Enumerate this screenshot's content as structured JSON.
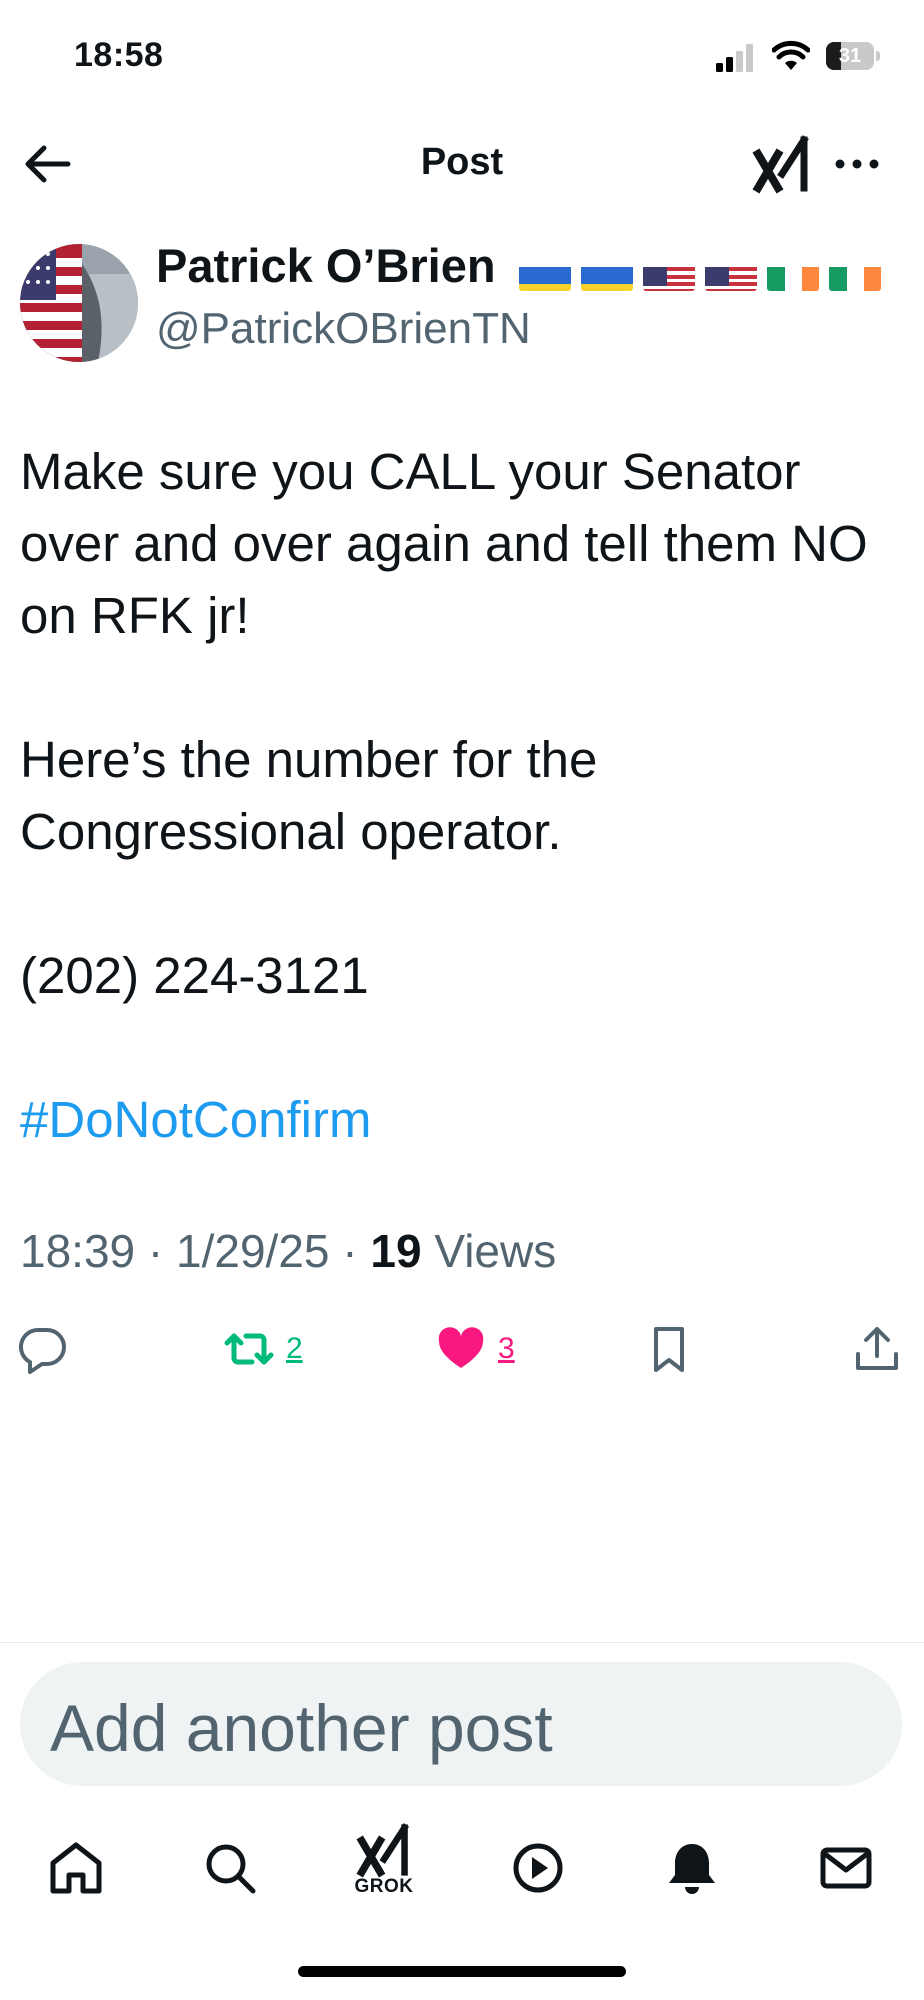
{
  "status_bar": {
    "time": "18:58",
    "battery_level": "31",
    "battery_fraction": 0.31,
    "icons": [
      "signal-icon",
      "wifi-icon",
      "battery-icon"
    ]
  },
  "header": {
    "title": "Post",
    "back_icon": "arrow-left-icon",
    "grok_icon": "grok-logo-icon",
    "more_icon": "more-horizontal-icon"
  },
  "post": {
    "author_name": "Patrick O’Brien",
    "author_flags": [
      "ukraine-flag",
      "ukraine-flag",
      "usa-flag",
      "usa-flag",
      "ireland-flag",
      "ireland-flag"
    ],
    "handle": "@PatrickOBrienTN",
    "text": "Make sure you CALL your Senator over and over again and tell them NO on RFK jr!\n\nHere’s the number for the Congressional operator.\n\n(202) 224-3121",
    "hashtag": "#DoNotConfirm",
    "time": "18:39",
    "date": "1/29/25",
    "views_count": "19",
    "views_label": "Views",
    "separator": "·"
  },
  "actions": {
    "reply_icon": "reply-icon",
    "repost_count": "2",
    "like_count": "3",
    "bookmark_icon": "bookmark-icon",
    "share_icon": "share-icon"
  },
  "composer": {
    "placeholder": "Add another post"
  },
  "tab_bar": {
    "grok_label": "GROK",
    "tabs": [
      "home-icon",
      "search-icon",
      "grok-icon",
      "video-icon",
      "notifications-icon",
      "messages-icon"
    ]
  },
  "colors": {
    "link": "#1d9bf0",
    "repost_active": "#00ba7c",
    "like_active": "#f91880",
    "secondary_text": "#536471",
    "primary_text": "#0f1419"
  }
}
